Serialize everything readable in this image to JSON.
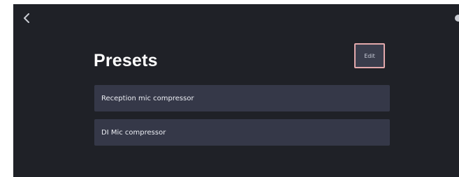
{
  "header": {
    "back_icon": "chevron-left-icon",
    "right_icon": "circle-icon"
  },
  "main": {
    "title": "Presets",
    "edit_label": "Edit"
  },
  "presets": [
    {
      "label": "Reception mic compressor"
    },
    {
      "label": "DI Mic compressor"
    }
  ],
  "colors": {
    "background": "#1f2127",
    "item_background": "#353848",
    "edit_border": "#e3a9ac"
  }
}
